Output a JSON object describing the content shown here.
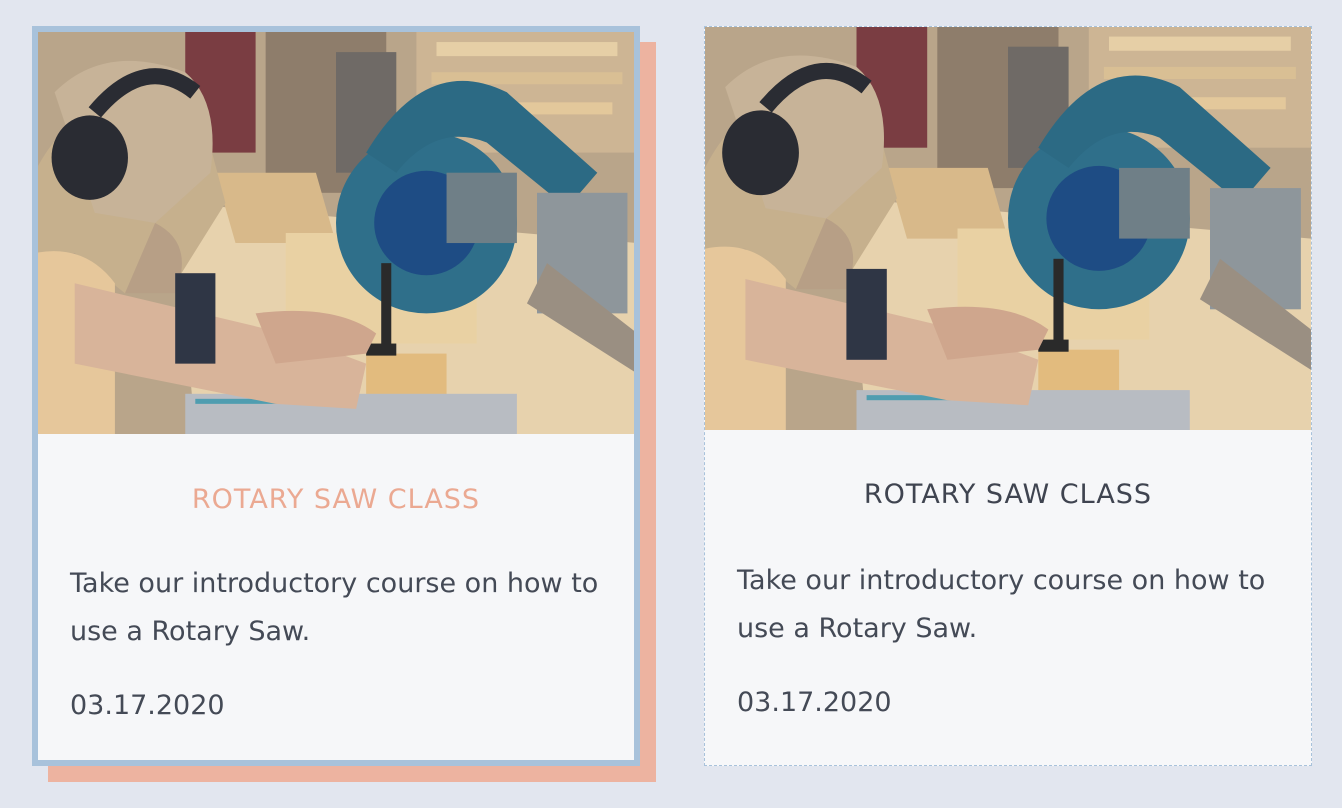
{
  "cards": [
    {
      "state": "hover",
      "title": "ROTARY SAW CLASS",
      "description": "Take our introductory course on how to use a Rotary Saw.",
      "date": "03.17.2020",
      "image_icon": "miter-saw-photo"
    },
    {
      "state": "default",
      "title": "ROTARY SAW CLASS",
      "description": "Take our introductory course on how to use a Rotary Saw.",
      "date": "03.17.2020",
      "image_icon": "miter-saw-photo"
    }
  ],
  "colors": {
    "page_background": "#e2e6ef",
    "card_background": "#f6f7f9",
    "card_border": "#a8c2db",
    "hover_shadow": "#edb3a0",
    "hover_title": "#eba992",
    "default_title": "#3f4450",
    "body_text": "#444a56"
  }
}
